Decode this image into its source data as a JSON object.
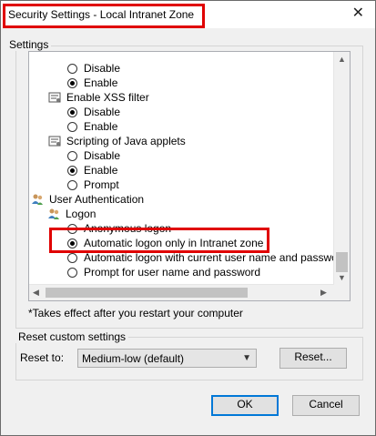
{
  "window": {
    "title": "Security Settings - Local Intranet Zone",
    "close_glyph": "✕"
  },
  "settings": {
    "group_label": "Settings",
    "items": [
      {
        "kind": "radio",
        "label": "Disable",
        "checked": false
      },
      {
        "kind": "radio",
        "label": "Enable",
        "checked": true
      },
      {
        "kind": "setting",
        "label": "Enable XSS filter",
        "icon": "settings-gear-icon"
      },
      {
        "kind": "radio",
        "label": "Disable",
        "checked": true
      },
      {
        "kind": "radio",
        "label": "Enable",
        "checked": false
      },
      {
        "kind": "setting",
        "label": "Scripting of Java applets",
        "icon": "settings-gear-icon"
      },
      {
        "kind": "radio",
        "label": "Disable",
        "checked": false
      },
      {
        "kind": "radio",
        "label": "Enable",
        "checked": true
      },
      {
        "kind": "radio",
        "label": "Prompt",
        "checked": false
      },
      {
        "kind": "category",
        "label": "User Authentication",
        "icon": "users-icon"
      },
      {
        "kind": "subcategory",
        "label": "Logon",
        "icon": "users-icon"
      },
      {
        "kind": "radio",
        "label": "Anonymous logon",
        "checked": false
      },
      {
        "kind": "radio",
        "label": "Automatic logon only in Intranet zone",
        "checked": true
      },
      {
        "kind": "radio",
        "label": "Automatic logon with current user name and password",
        "checked": false
      },
      {
        "kind": "radio",
        "label": "Prompt for user name and password",
        "checked": false
      }
    ]
  },
  "note": "*Takes effect after you restart your computer",
  "reset": {
    "group_label": "Reset custom settings",
    "label": "Reset to:",
    "selected": "Medium-low (default)",
    "button": "Reset..."
  },
  "buttons": {
    "ok": "OK",
    "cancel": "Cancel"
  },
  "colors": {
    "highlight": "#e00000",
    "default_button_border": "#0078d7"
  }
}
